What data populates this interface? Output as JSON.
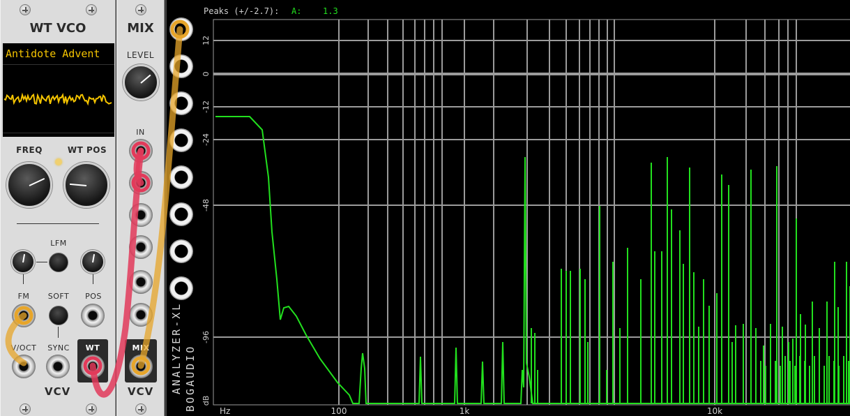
{
  "wt_vco": {
    "title": "WT VCO",
    "wavetable_name": "Antidote Advent",
    "freq_label": "FREQ",
    "wtpos_label": "WT POS",
    "lfm_label": "LFM",
    "fm_label": "FM",
    "soft_label": "SOFT",
    "pos_label": "POS",
    "voct_label": "V/OCT",
    "sync_label": "SYNC",
    "wt_out_label": "WT",
    "brand": "VCV"
  },
  "mix": {
    "title": "MIX",
    "level_label": "LEVEL",
    "in_label": "IN",
    "mix_out_label": "MIX",
    "brand": "VCV"
  },
  "analyzer": {
    "peaks_label": "Peaks (+/-2.7):",
    "channel_label": "A:",
    "channel_value": "1.3",
    "module_name": "ANALYZER-XL",
    "brand": "BOGAUDIO",
    "y_unit": "dB",
    "x_unit": "Hz",
    "y_ticks": [
      "12",
      "0",
      "-12",
      "-24",
      "-48",
      "-96"
    ],
    "x_ticks": [
      "100",
      "1k",
      "10k"
    ],
    "colors": {
      "trace": "#22e01e",
      "grid": "#9b9b9b",
      "bg": "#000000",
      "channel": "#22e01e"
    }
  },
  "cables": {
    "orange": "#e7a52a",
    "red": "#e23a5a"
  },
  "display": {
    "wave_color": "#f5c400",
    "text_color": "#f5c400"
  }
}
